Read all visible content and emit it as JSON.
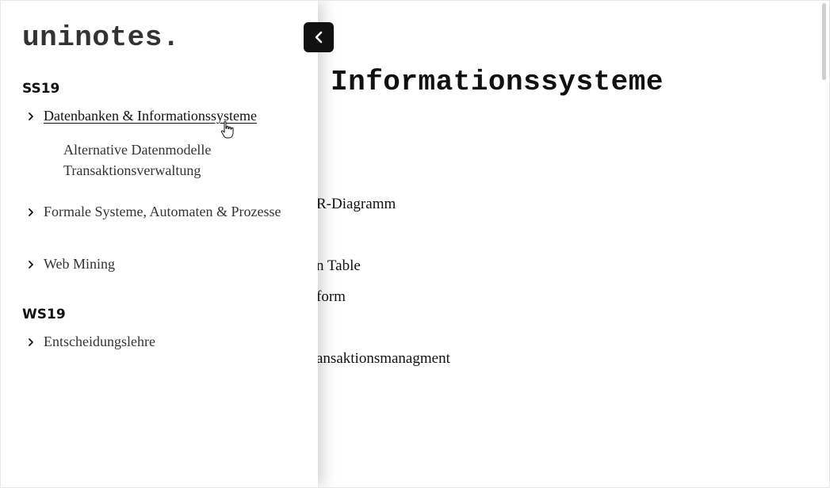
{
  "brand": "uninotes.",
  "collapse_button": {
    "icon": "chevron-left-icon"
  },
  "main": {
    "title": "Informationssysteme",
    "links": [
      {
        "label": "R-Diagramm"
      },
      {
        "label": "n Table"
      },
      {
        "label": "form"
      },
      {
        "label": "ansaktionsmanagment"
      }
    ]
  },
  "sidebar": {
    "sections": [
      {
        "title": "SS19",
        "items": [
          {
            "label": "Datenbanken & Informationssysteme",
            "subitems": [
              "Alternative Datenmodelle",
              "Transaktionsverwaltung"
            ]
          },
          {
            "label": "Formale Systeme, Automaten & Prozesse"
          },
          {
            "label": "Web Mining"
          }
        ]
      },
      {
        "title": "WS19",
        "items": [
          {
            "label": "Entscheidungslehre"
          }
        ]
      }
    ]
  }
}
